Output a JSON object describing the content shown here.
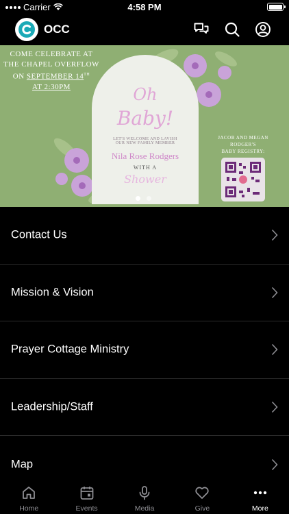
{
  "status": {
    "carrier": "Carrier",
    "time": "4:58 PM"
  },
  "header": {
    "title": "OCC",
    "icons": [
      "chat-icon",
      "search-icon",
      "profile-icon"
    ],
    "logo_color": "#1aa9b6"
  },
  "banner": {
    "left_lines": [
      "COME CELEBRATE AT",
      "THE CHAPEL OVERFLOW",
      "ON",
      "SEPTEMBER 14",
      "TH",
      "AT 2:30PM"
    ],
    "oh": "Oh",
    "baby": "Baby!",
    "welcome_line1": "LET'S WELCOME AND LAVISH",
    "welcome_line2": "OUR NEW FAMILY MEMBER",
    "name": "Nila Rose Rodgers",
    "with_a": "WITH A",
    "shower": "Shower",
    "registry_line1": "JACOB AND MEGAN",
    "registry_line2": "RODGER'S",
    "registry_line3": "BABY REGISTRY:",
    "page_count": 2,
    "active_page": 1,
    "bg_color": "#8faf73"
  },
  "menu": [
    {
      "label": "Contact Us"
    },
    {
      "label": "Mission & Vision"
    },
    {
      "label": "Prayer Cottage Ministry"
    },
    {
      "label": "Leadership/Staff"
    },
    {
      "label": "Map"
    }
  ],
  "tabs": [
    {
      "label": "Home",
      "icon": "home-icon"
    },
    {
      "label": "Events",
      "icon": "calendar-icon"
    },
    {
      "label": "Media",
      "icon": "microphone-icon"
    },
    {
      "label": "Give",
      "icon": "heart-icon"
    },
    {
      "label": "More",
      "icon": "more-icon",
      "active": true
    }
  ]
}
